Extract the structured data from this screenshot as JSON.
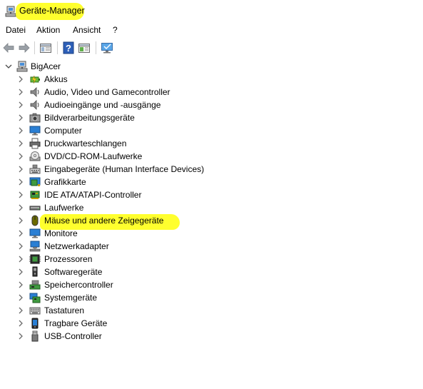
{
  "window": {
    "title": "Geräte-Manager"
  },
  "menu": {
    "items": [
      "Datei",
      "Aktion",
      "Ansicht",
      "?"
    ]
  },
  "toolbar": {
    "buttons": [
      "back-arrow-icon",
      "forward-arrow-icon",
      "properties-icon",
      "help-icon",
      "show-hidden-icon",
      "monitor-scan-icon"
    ]
  },
  "tree": {
    "root": {
      "label": "BigAcer",
      "icon": "computer-root-icon"
    },
    "children": [
      {
        "label": "Akkus",
        "icon": "battery-icon"
      },
      {
        "label": "Audio, Video und Gamecontroller",
        "icon": "speaker-icon"
      },
      {
        "label": "Audioeingänge und -ausgänge",
        "icon": "speaker-icon"
      },
      {
        "label": "Bildverarbeitungsgeräte",
        "icon": "camera-icon"
      },
      {
        "label": "Computer",
        "icon": "monitor-icon"
      },
      {
        "label": "Druckwarteschlangen",
        "icon": "printer-icon"
      },
      {
        "label": "DVD/CD-ROM-Laufwerke",
        "icon": "disc-icon"
      },
      {
        "label": "Eingabegeräte (Human Interface Devices)",
        "icon": "hid-icon"
      },
      {
        "label": "Grafikkarte",
        "icon": "graphics-card-icon"
      },
      {
        "label": "IDE ATA/ATAPI-Controller",
        "icon": "ide-controller-icon"
      },
      {
        "label": "Laufwerke",
        "icon": "drive-icon"
      },
      {
        "label": "Mäuse und andere Zeigegeräte",
        "icon": "mouse-icon"
      },
      {
        "label": "Monitore",
        "icon": "monitor-icon"
      },
      {
        "label": "Netzwerkadapter",
        "icon": "network-adapter-icon"
      },
      {
        "label": "Prozessoren",
        "icon": "processor-icon"
      },
      {
        "label": "Softwaregeräte",
        "icon": "software-device-icon"
      },
      {
        "label": "Speichercontroller",
        "icon": "storage-controller-icon"
      },
      {
        "label": "Systemgeräte",
        "icon": "system-device-icon"
      },
      {
        "label": "Tastaturen",
        "icon": "keyboard-icon"
      },
      {
        "label": "Tragbare Geräte",
        "icon": "portable-device-icon"
      },
      {
        "label": "USB-Controller",
        "icon": "usb-icon"
      }
    ]
  },
  "colors": {
    "highlight": "#ffff2e",
    "icon_blue": "#2a7fd4",
    "chevron": "#6b6b6b"
  }
}
